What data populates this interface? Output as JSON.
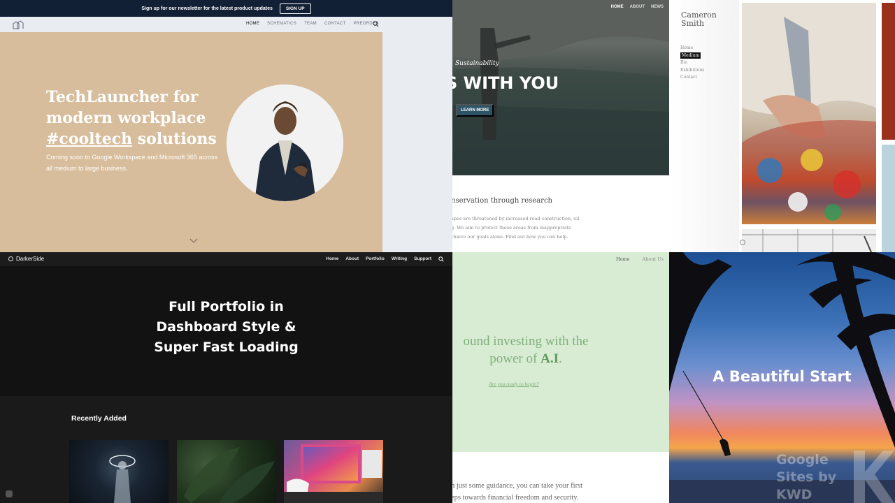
{
  "panel1": {
    "banner_text": "Sign up for our newsletter for the latest product updates",
    "signup_label": "SIGN UP",
    "nav": [
      "HOME",
      "SCHEMATICS",
      "TEAM",
      "CONTACT",
      "PREORDER"
    ],
    "hero_line1": "TechLauncher for",
    "hero_line2": "modern workplace",
    "hero_hashtag": "#cooltech",
    "hero_line3_rest": " solutions",
    "hero_sub": "Coming soon to Google Workspace and Microsoft 365 across all medium to large business."
  },
  "panel2": {
    "nav": [
      "HOME",
      "ABOUT",
      "NEWS"
    ],
    "kicker": "Sustainability",
    "headline": "S WITH YOU",
    "learn_more": "LEARN MORE",
    "title": "nservation through research",
    "body_line1": "apes are threatened by increased road construction, oil",
    "body_line2": "g. We aim to protect these areas from inappropriate",
    "body_line3": "chieve our goals alone. Find out how you can help."
  },
  "panel3": {
    "name_line1": "Cameron",
    "name_line2": "Smith",
    "menu": [
      "Home",
      "Medium",
      "Bio",
      "Exhibitions",
      "Contact"
    ]
  },
  "panel4": {
    "brand": "DarkerSide",
    "nav": [
      "Home",
      "About",
      "Portfolio",
      "Writing",
      "Support"
    ],
    "hero_line1": "Full Portfolio in",
    "hero_line2": "Dashboard Style &",
    "hero_line3": "Super Fast Loading",
    "section_title": "Recently Added"
  },
  "panel5": {
    "nav": [
      "Home",
      "About Us"
    ],
    "headline_line1": "ound investing with the",
    "headline_line2_pre": "power of ",
    "headline_line2_bold": "A.I",
    "headline_line2_post": ".",
    "cta": "Are you ready to begin?",
    "body_line1": "h just some guidance, you can take your first",
    "body_line2": "eps towards financial freedom and security."
  },
  "panel6": {
    "headline": "A Beautiful Start",
    "watermark_line1": "Google",
    "watermark_line2": "Sites by",
    "watermark_line3": "KWD"
  },
  "colors": {
    "tech_hero": "#d7bd9b",
    "tech_banner": "#122035",
    "darker_bg": "#151515",
    "invest_green": "#d8ebd3",
    "invest_text": "#7fb07a"
  },
  "icons": [
    "houses-logo-icon",
    "search-icon",
    "chevron-down-icon",
    "info-icon",
    "circle-logo-icon"
  ]
}
